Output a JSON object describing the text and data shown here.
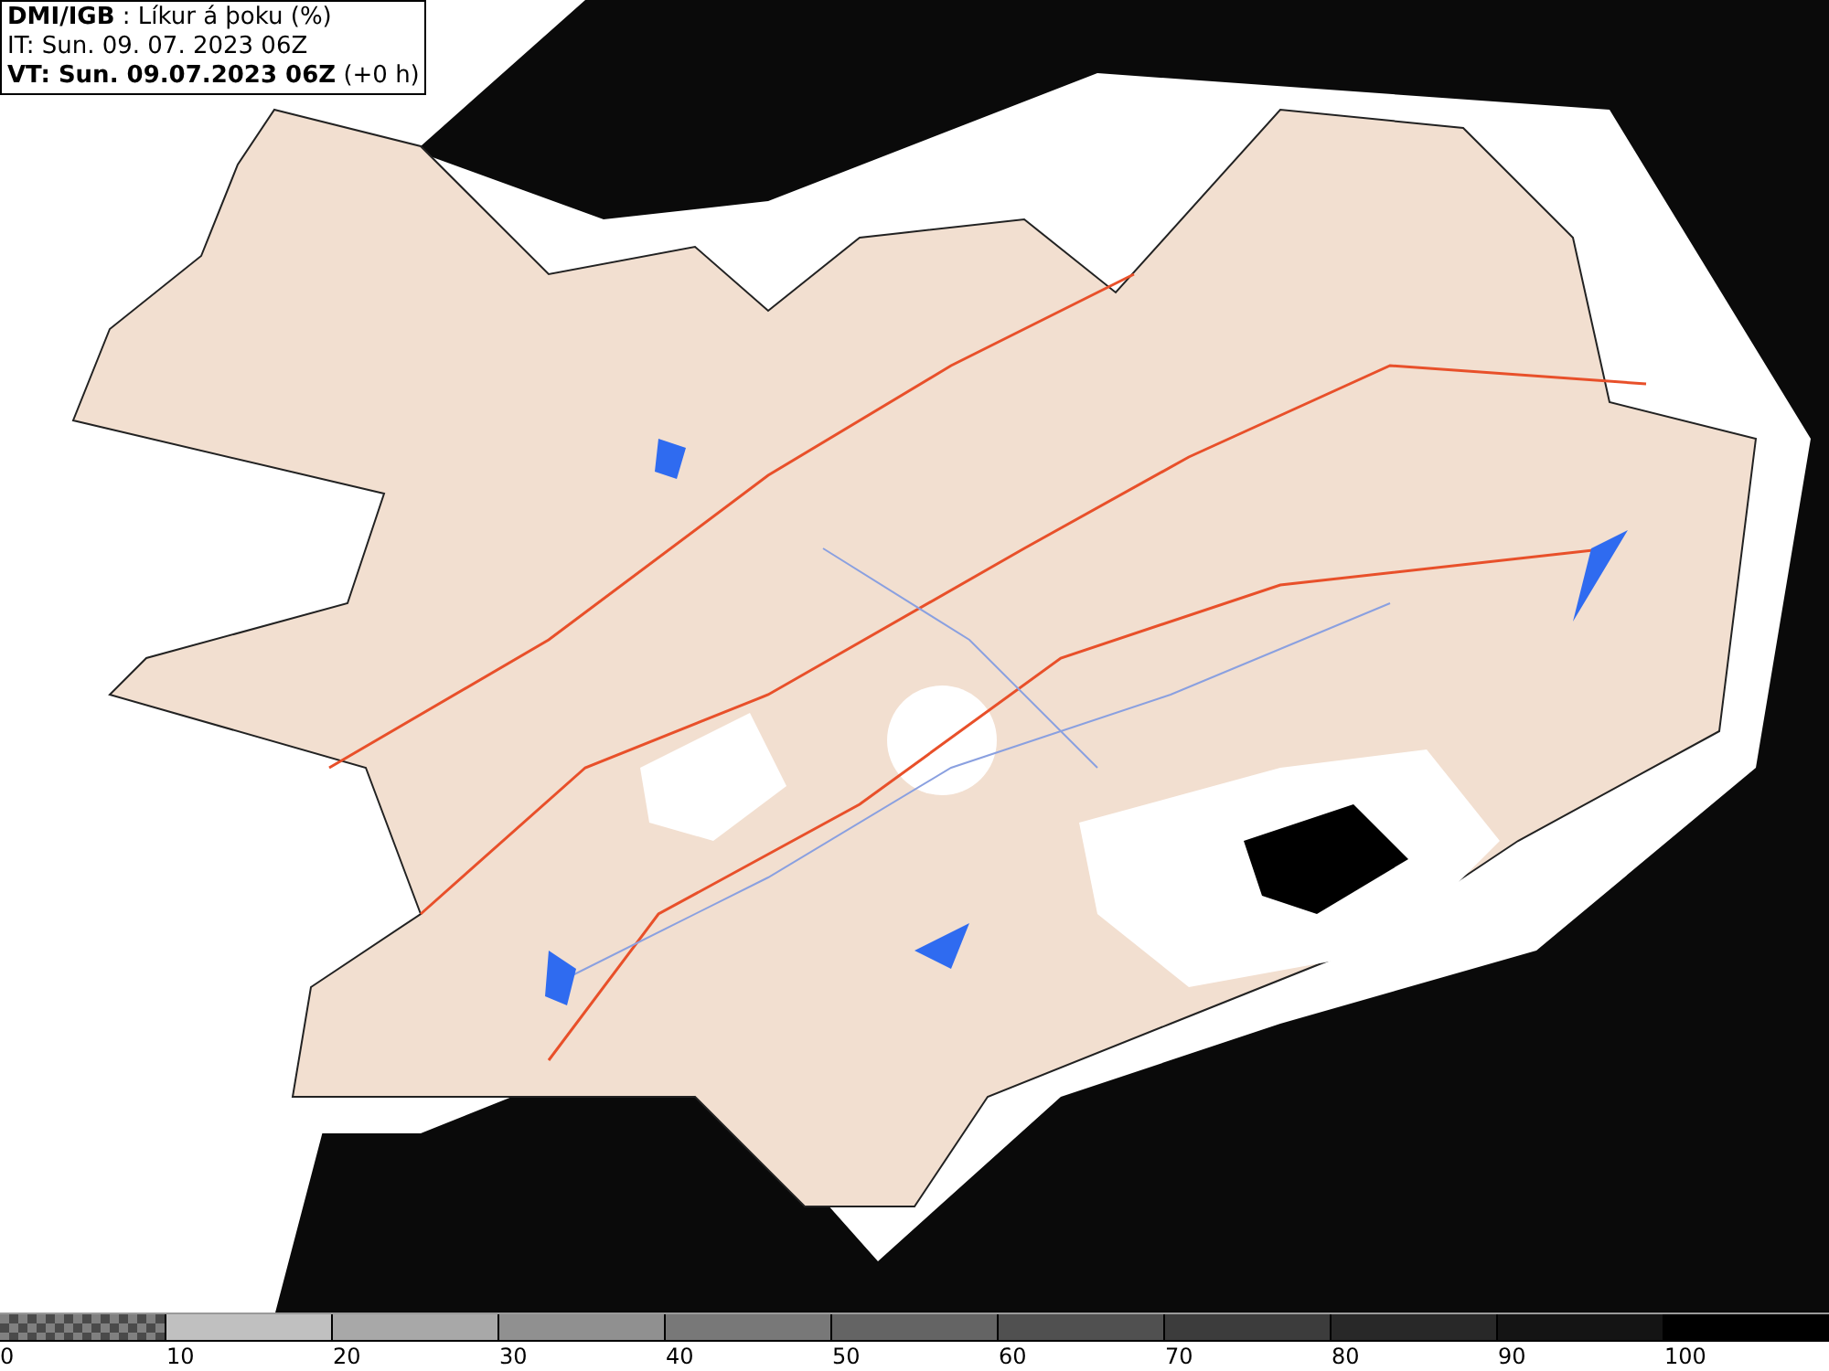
{
  "header": {
    "lines": [
      "**DMI/IGB** : Líkur á þoku (%)",
      "IT: Sun. 09. 07. 2023 06Z",
      "**VT: Sun. 09.07.2023 06Z** (+0 h)"
    ]
  },
  "legend": [
    {
      "label": "0",
      "kind": "checker",
      "color": "#808080"
    },
    {
      "label": "10",
      "kind": "solid",
      "color": "#c0c0c0"
    },
    {
      "label": "20",
      "kind": "solid",
      "color": "#a8a8a8"
    },
    {
      "label": "30",
      "kind": "solid",
      "color": "#909090"
    },
    {
      "label": "40",
      "kind": "solid",
      "color": "#787878"
    },
    {
      "label": "50",
      "kind": "solid",
      "color": "#646464"
    },
    {
      "label": "60",
      "kind": "solid",
      "color": "#505050"
    },
    {
      "label": "70",
      "kind": "solid",
      "color": "#3c3c3c"
    },
    {
      "label": "80",
      "kind": "solid",
      "color": "#282828"
    },
    {
      "label": "90",
      "kind": "solid",
      "color": "#141414"
    },
    {
      "label": "100",
      "kind": "solid",
      "color": "#000000"
    }
  ]
}
